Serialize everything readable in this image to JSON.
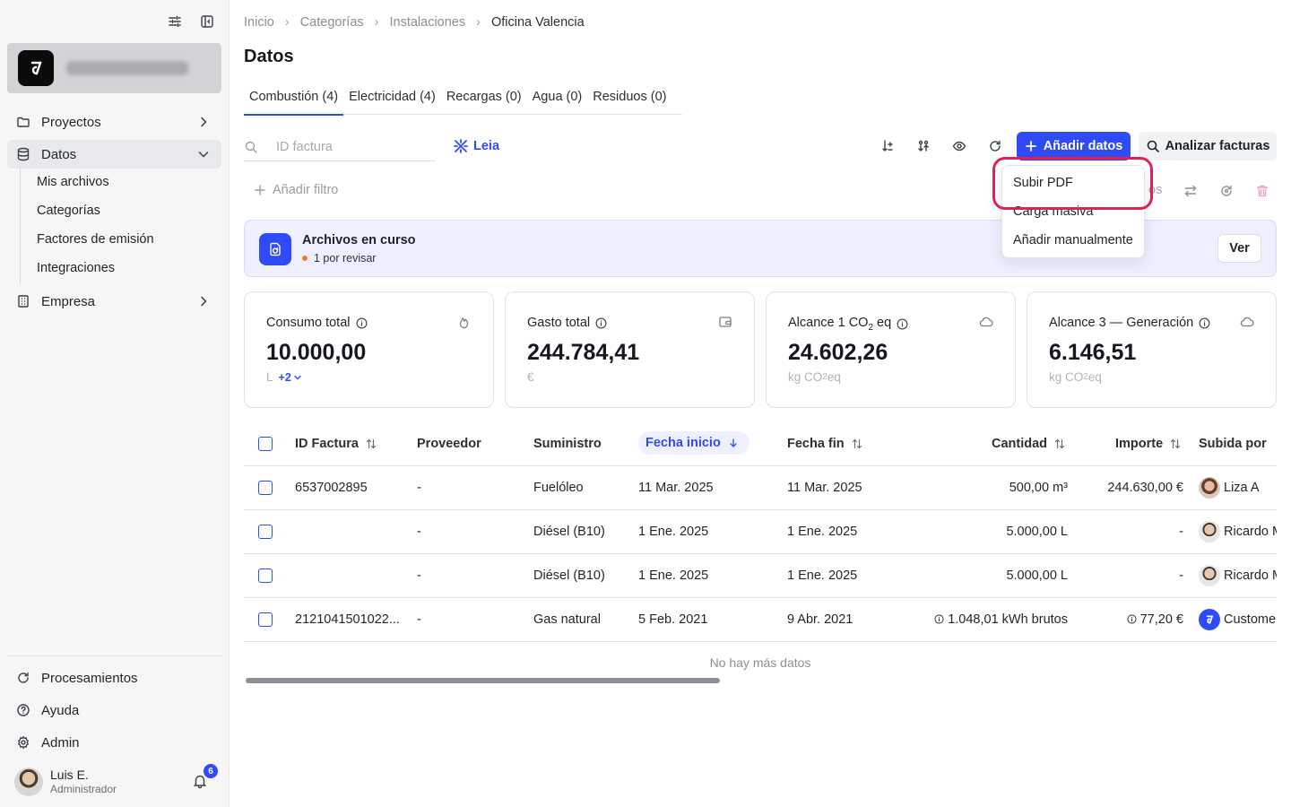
{
  "sidebar": {
    "nav": [
      {
        "label": "Proyectos"
      },
      {
        "label": "Datos"
      },
      {
        "label": "Empresa"
      }
    ],
    "sub_items": [
      "Mis archivos",
      "Categorías",
      "Factores de emisión",
      "Integraciones"
    ],
    "bottom": [
      {
        "label": "Procesamientos"
      },
      {
        "label": "Ayuda"
      },
      {
        "label": "Admin"
      }
    ],
    "user": {
      "name": "Luis E.",
      "role": "Administrador",
      "notifications": "6"
    }
  },
  "breadcrumb": [
    "Inicio",
    "Categorías",
    "Instalaciones",
    "Oficina Valencia"
  ],
  "page_title": "Datos",
  "tabs": [
    "Combustión (4)",
    "Electricidad (4)",
    "Recargas (0)",
    "Agua (0)",
    "Residuos (0)"
  ],
  "toolbar": {
    "search_placeholder": "ID factura",
    "leia_label": "Leia",
    "add_data_label": "Añadir datos",
    "analyze_label": "Analizar facturas",
    "add_filter_label": "Añadir filtro",
    "hidden_partial": "os"
  },
  "dropdown": [
    "Subir PDF",
    "Carga masiva",
    "Añadir manualmente"
  ],
  "banner": {
    "title": "Archivos en curso",
    "subtitle": "1 por revisar",
    "button": "Ver"
  },
  "cards": [
    {
      "title": "Consumo total",
      "value": "10.000,00",
      "unit": "L",
      "extra": "+2",
      "icon": "flame-icon"
    },
    {
      "title": "Gasto total",
      "value": "244.784,41",
      "unit": "€",
      "icon": "wallet-icon"
    },
    {
      "title_pre": "Alcance 1 CO",
      "title_sub": "2",
      "title_post": " eq",
      "value": "24.602,26",
      "unit_pre": "kg CO",
      "unit_sub": "2",
      "unit_post": " eq",
      "icon": "cloud-icon"
    },
    {
      "title": "Alcance 3 — Generación",
      "value": "6.146,51",
      "unit_pre": "kg CO",
      "unit_sub": "2",
      "unit_post": " eq",
      "icon": "cloud-icon"
    }
  ],
  "table": {
    "headers": [
      "ID Factura",
      "Proveedor",
      "Suministro",
      "Fecha inicio",
      "Fecha fin",
      "Cantidad",
      "Importe",
      "Subida por"
    ],
    "rows": [
      {
        "id": "6537002895",
        "proveedor": "-",
        "suministro": "Fuelóleo",
        "inicio": "11 Mar. 2025",
        "fin": "11 Mar. 2025",
        "cantidad": "500,00 m³",
        "importe": "244.630,00 €",
        "subida": "Liza A"
      },
      {
        "id": "",
        "proveedor": "-",
        "suministro": "Diésel (B10)",
        "inicio": "1 Ene. 2025",
        "fin": "1 Ene. 2025",
        "cantidad": "5.000,00 L",
        "importe": "-",
        "subida": "Ricardo M"
      },
      {
        "id": "",
        "proveedor": "-",
        "suministro": "Diésel (B10)",
        "inicio": "1 Ene. 2025",
        "fin": "1 Ene. 2025",
        "cantidad": "5.000,00 L",
        "importe": "-",
        "subida": "Ricardo M"
      },
      {
        "id": "2121041501022...",
        "proveedor": "-",
        "suministro": "Gas natural",
        "inicio": "5 Feb. 2021",
        "fin": "9 Abr. 2021",
        "cantidad": "1.048,01 kWh brutos",
        "importe": "77,20 €",
        "subida": "Customer"
      }
    ],
    "footer": "No hay más datos"
  },
  "colors": {
    "accent": "#2f4bf7",
    "highlight": "#e02155",
    "banner_bg": "#eef0ff"
  }
}
